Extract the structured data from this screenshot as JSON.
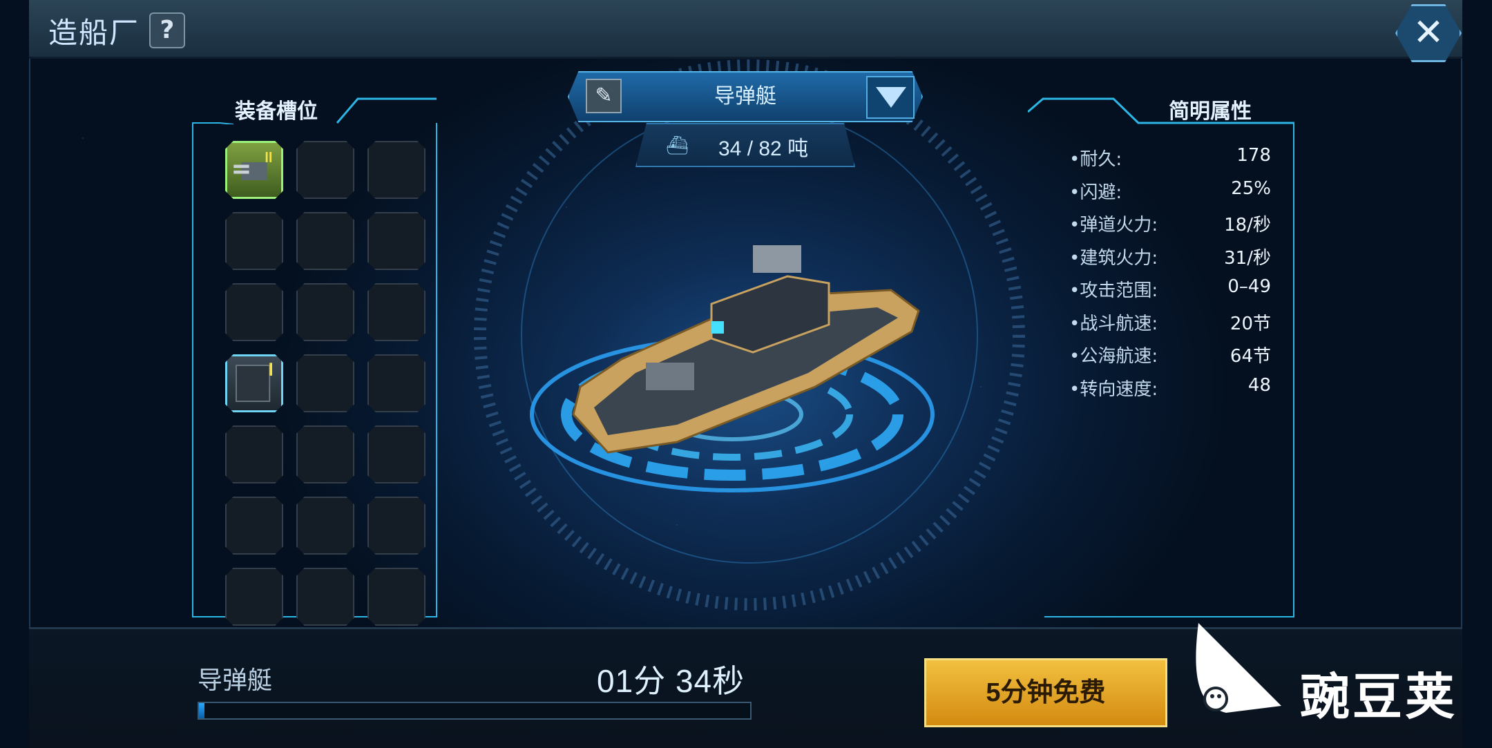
{
  "header": {
    "title": "造船厂",
    "help_label": "?",
    "close_label": "✕"
  },
  "equipment": {
    "title": "装备槽位",
    "filled_slots": [
      {
        "row": 0,
        "col": 0,
        "icon": "cannon-turret-icon"
      },
      {
        "row": 3,
        "col": 0,
        "icon": "armor-plate-icon"
      }
    ]
  },
  "ship": {
    "name": "导弹艇",
    "tonnage": "34 / 82 吨",
    "edit_icon": "rename-icon",
    "dropdown_icon": "dropdown-arrow-icon",
    "tonnage_icon": "ship-weight-icon"
  },
  "stats": {
    "title": "简明属性",
    "rows": [
      {
        "label": "•耐久:",
        "value": "178"
      },
      {
        "label": "•闪避:",
        "value": "25%"
      },
      {
        "label": "•弹道火力:",
        "value": "18/秒"
      },
      {
        "label": "•建筑火力:",
        "value": "31/秒"
      },
      {
        "label": "•攻击范围:",
        "value": "0–49"
      },
      {
        "label": "•战斗航速:",
        "value": "20节"
      },
      {
        "label": "•公海航速:",
        "value": "64节"
      },
      {
        "label": "•转向速度:",
        "value": "48"
      }
    ]
  },
  "build": {
    "name": "导弹艇",
    "timer": "01分 34秒",
    "progress": 0.01,
    "free_button": "5分钟免费"
  },
  "watermark": {
    "text": "豌豆荚"
  },
  "colors": {
    "accent": "#2bb6e6",
    "button_gold": "#e3a52a",
    "slot_green": "#9df07a",
    "slot_blue": "#6ed5f5"
  }
}
